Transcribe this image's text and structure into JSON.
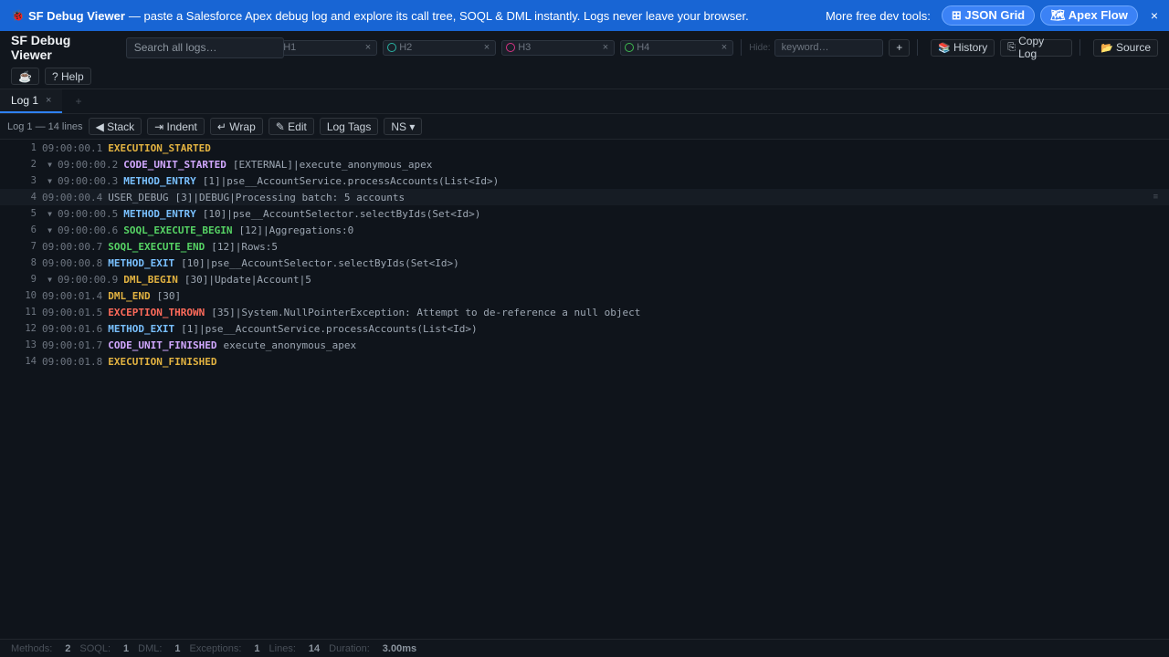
{
  "banner": {
    "name": "SF Debug Viewer",
    "tagline": "— paste a Salesforce Apex debug log and explore its call tree, SOQL & DML instantly. Logs never leave your browser.",
    "more_label": "More free dev tools:",
    "links": [
      {
        "icon": "grid-icon",
        "glyph": "⊞",
        "label": "JSON Grid"
      },
      {
        "icon": "map-icon",
        "glyph": "🗺",
        "label": "Apex Flow"
      }
    ],
    "close": "×"
  },
  "toolbar": {
    "title": "SF Debug Viewer",
    "search_placeholder": "Search all logs…",
    "highlights": [
      {
        "label": "H1",
        "color": ""
      },
      {
        "label": "H2",
        "color": "#2ab3a3"
      },
      {
        "label": "H3",
        "color": "#d63384"
      },
      {
        "label": "H4",
        "color": "#3fb950"
      }
    ],
    "hide_label": "Hide:",
    "keyword_placeholder": "keyword…",
    "add_label": "+",
    "history_label": "History",
    "copy_label": "Copy Log",
    "source_label": "Source",
    "coffee_glyph": "☕",
    "help_label": "? Help"
  },
  "tabs": [
    {
      "label": "Log 1",
      "close": "×"
    }
  ],
  "tab_add": "+",
  "logbar": {
    "info": "Log 1 — 14 lines",
    "buttons": [
      "◀ Stack",
      "⇥ Indent",
      "↵ Wrap",
      "✎ Edit",
      "Log Tags",
      "NS ▾"
    ]
  },
  "colors": {
    "yellow": "#e3b341",
    "purple": "#d2a8ff",
    "blue": "#79c0ff",
    "green": "#56d364",
    "red": "#ff6b5b",
    "plain": "#9da7b3"
  },
  "lines": [
    {
      "n": "1",
      "fold": "",
      "ts": "09:00:00.1",
      "ev": "EXECUTION_STARTED",
      "color": "yellow",
      "det": ""
    },
    {
      "n": "2",
      "fold": "▼",
      "ts": "09:00:00.2",
      "ev": "CODE_UNIT_STARTED",
      "color": "purple",
      "det": "[EXTERNAL]|execute_anonymous_apex"
    },
    {
      "n": "3",
      "fold": "▼",
      "ts": "09:00:00.3",
      "ev": "METHOD_ENTRY",
      "color": "blue",
      "det": "[1]|pse__AccountService.processAccounts(List<Id>)"
    },
    {
      "n": "4",
      "fold": "",
      "ts": "09:00:00.4",
      "ev": "USER_DEBUG",
      "color": "plain",
      "det": "[3]|DEBUG|Processing batch: 5 accounts",
      "hover": true
    },
    {
      "n": "5",
      "fold": "▼",
      "ts": "09:00:00.5",
      "ev": "METHOD_ENTRY",
      "color": "blue",
      "det": "[10]|pse__AccountSelector.selectByIds(Set<Id>)"
    },
    {
      "n": "6",
      "fold": "▼",
      "ts": "09:00:00.6",
      "ev": "SOQL_EXECUTE_BEGIN",
      "color": "green",
      "det": "[12]|Aggregations:0"
    },
    {
      "n": "7",
      "fold": "",
      "ts": "09:00:00.7",
      "ev": "SOQL_EXECUTE_END",
      "color": "green",
      "det": "[12]|Rows:5"
    },
    {
      "n": "8",
      "fold": "",
      "ts": "09:00:00.8",
      "ev": "METHOD_EXIT",
      "color": "blue",
      "det": "[10]|pse__AccountSelector.selectByIds(Set<Id>)"
    },
    {
      "n": "9",
      "fold": "▼",
      "ts": "09:00:00.9",
      "ev": "DML_BEGIN",
      "color": "yellow",
      "det": "[30]|Update|Account|5"
    },
    {
      "n": "10",
      "fold": "",
      "ts": "09:00:01.4",
      "ev": "DML_END",
      "color": "yellow",
      "det": "[30]"
    },
    {
      "n": "11",
      "fold": "",
      "ts": "09:00:01.5",
      "ev": "EXCEPTION_THROWN",
      "color": "red",
      "det": "[35]|System.NullPointerException: Attempt to de-reference a null object"
    },
    {
      "n": "12",
      "fold": "",
      "ts": "09:00:01.6",
      "ev": "METHOD_EXIT",
      "color": "blue",
      "det": "[1]|pse__AccountService.processAccounts(List<Id>)"
    },
    {
      "n": "13",
      "fold": "",
      "ts": "09:00:01.7",
      "ev": "CODE_UNIT_FINISHED",
      "color": "purple",
      "det": "execute_anonymous_apex"
    },
    {
      "n": "14",
      "fold": "",
      "ts": "09:00:01.8",
      "ev": "EXECUTION_FINISHED",
      "color": "yellow",
      "det": ""
    }
  ],
  "hover_mark": "≡",
  "status": [
    {
      "label": "Methods:",
      "value": "2"
    },
    {
      "label": "SOQL:",
      "value": "1"
    },
    {
      "label": "DML:",
      "value": "1"
    },
    {
      "label": "Exceptions:",
      "value": "1"
    },
    {
      "label": "Lines:",
      "value": "14"
    },
    {
      "label": "Duration:",
      "value": "3.00ms"
    }
  ]
}
